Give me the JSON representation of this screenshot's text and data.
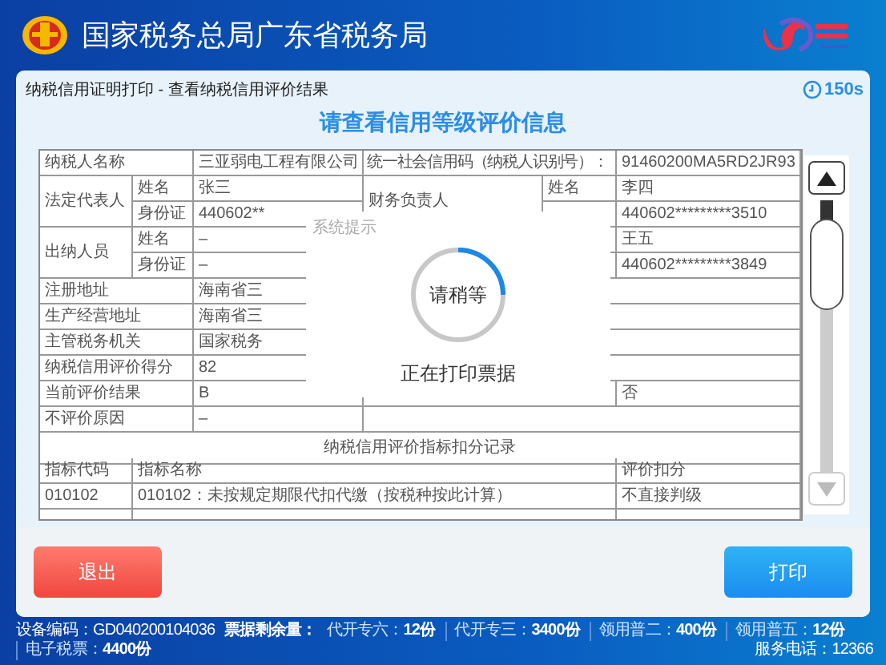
{
  "header": {
    "title": "国家税务总局广东省税务局"
  },
  "breadcrumb": "纳税信用证明打印 - 查看纳税信用评价结果",
  "timer": "150s",
  "heading": "请查看信用等级评价信息",
  "form": {
    "entries": [
      {
        "kind": "field",
        "label": "纳税人名称",
        "value": "三亚弱电工程有限公司",
        "label_2": "统一社会信用码（纳税人识别号）：",
        "value_2": "91460200MA5RD2JR93"
      },
      {
        "kind": "person",
        "role": "法定代表人",
        "name_label": "姓名",
        "name": "张三",
        "id_label": "身份证",
        "id": "440602**",
        "role_2": "财务负责人",
        "name_label_2": "姓名",
        "name_2": "李四",
        "id_2": "440602*********3510"
      },
      {
        "kind": "person",
        "role": "出纳人员",
        "name_label": "姓名",
        "name": "–",
        "id_label": "身份证",
        "id": "–",
        "name_2": "王五",
        "id_2": "440602*********3849"
      },
      {
        "kind": "field",
        "label": "注册地址",
        "value": "海南省三"
      },
      {
        "kind": "field",
        "label": "生产经营地址",
        "value": "海南省三"
      },
      {
        "kind": "field",
        "label": "主管税务机关",
        "value": "国家税务"
      },
      {
        "kind": "field",
        "label": "纳税信用评价得分",
        "value": "82"
      },
      {
        "kind": "field",
        "label": "当前评价结果",
        "value": "B",
        "value_2": "否"
      },
      {
        "kind": "field",
        "label": "不评价原因",
        "value": "–"
      }
    ]
  },
  "deductions": {
    "title": "纳税信用评价指标扣分记录",
    "columns": [
      "指标代码",
      "指标名称",
      "评价扣分"
    ],
    "rows": [
      {
        "code": "010102",
        "name": "010102：未按规定期限代扣代缴（按税种按此计算）",
        "score": "不直接判级"
      }
    ]
  },
  "dialog": {
    "title": "系统提示",
    "spinner_text": "请稍等",
    "message": "正在打印票据"
  },
  "buttons": [
    {
      "kind": "exit",
      "label": "退出"
    },
    {
      "kind": "print",
      "label": "打印"
    }
  ],
  "status_bar": {
    "device": "设备编码：GD040200104036",
    "stock_label": "票据剩余量：",
    "stock": [
      {
        "label": "代开专六：",
        "value": "12份"
      },
      {
        "label": "代开专三：",
        "value": "3400份"
      },
      {
        "label": "领用普二：",
        "value": "400份"
      },
      {
        "label": "领用普五：",
        "value": "12份"
      },
      {
        "label": "电子税票：",
        "value": "4400份"
      }
    ],
    "service": "服务电话：12366"
  }
}
